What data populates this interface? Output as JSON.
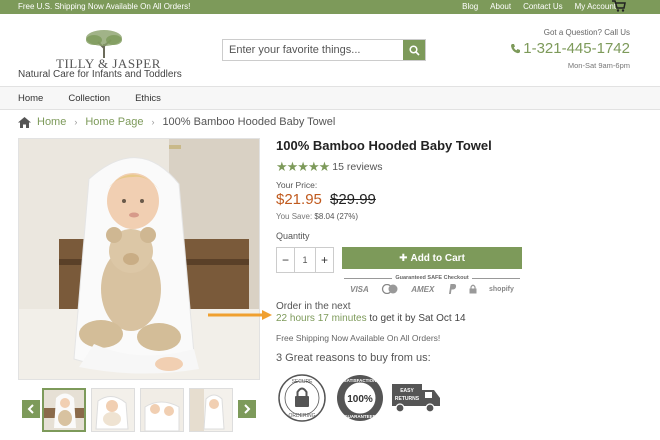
{
  "topbar": {
    "promo": "Free U.S. Shipping Now Available On All Orders!",
    "links": [
      "Blog",
      "About",
      "Contact Us",
      "My Account"
    ],
    "cart_icon": "cart-icon"
  },
  "header": {
    "logo_text": "TILLY & JASPER",
    "tagline": "Natural Care for Infants and Toddlers",
    "search_placeholder": "Enter your favorite things...",
    "contact_question": "Got a Question? Call Us",
    "phone": "1-321-445-1742",
    "hours": "Mon-Sat 9am-6pm"
  },
  "nav": {
    "items": [
      "Home",
      "Collection",
      "Ethics"
    ]
  },
  "breadcrumb": {
    "home": "Home",
    "section": "Home Page",
    "current": "100% Bamboo Hooded Baby Towel"
  },
  "product": {
    "title": "100% Bamboo Hooded Baby Towel",
    "rating": 5,
    "reviews": "15 reviews",
    "price_label": "Your Price:",
    "price": "$21.95",
    "old_price": "$29.99",
    "you_save_label": "You Save:",
    "you_save": "$8.04 (27%)",
    "quantity_label": "Quantity",
    "quantity": "1",
    "add_to_cart": "Add to Cart",
    "secure_label": "Guaranteed SAFE Checkout",
    "payment_logos": [
      "VISA",
      "AMEX",
      "shopify"
    ],
    "order_line1": "Order in the next",
    "order_time": "22 hours 17 minutes",
    "order_rest": "to get it by Sat Oct 14",
    "free_shipping": "Free Shipping Now Available On All Orders!",
    "reasons_title": "3 Great reasons to buy from us:",
    "badges": [
      {
        "top": "SECURE",
        "bottom": "ORDERING"
      },
      {
        "top": "SATISFACTION",
        "mid": "100%",
        "bottom": "GUARANTEED"
      },
      {
        "top": "EASY",
        "bottom": "RETURNS"
      }
    ]
  },
  "colors": {
    "brand_green": "#7d9a5a",
    "price_orange": "#c05a1e",
    "callout_arrow": "#f0a030"
  }
}
